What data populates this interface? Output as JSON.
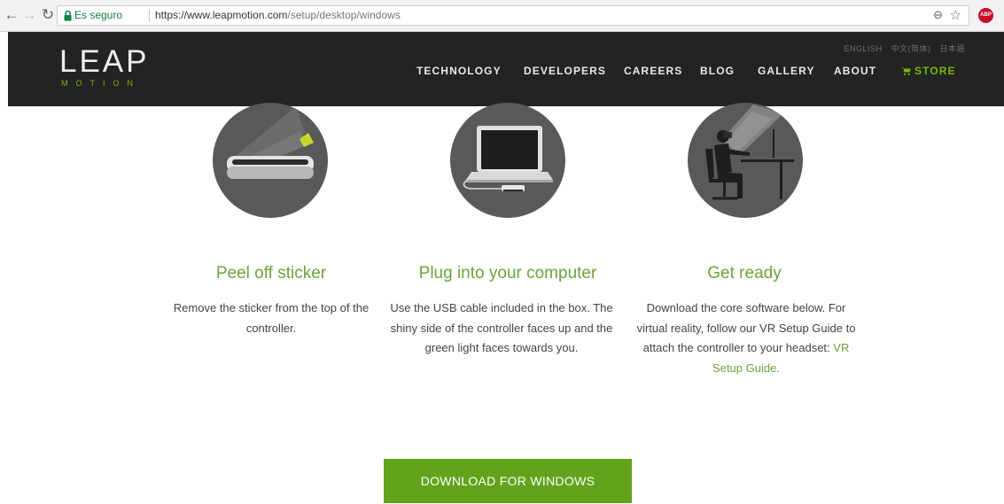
{
  "browser": {
    "secure_label": "Es seguro",
    "url_host": "https://www.leapmotion.com",
    "url_path": "/setup/desktop/windows",
    "extension_badge": "ABP"
  },
  "header": {
    "logo_primary": "LEAP",
    "logo_secondary": "MOTION",
    "languages": [
      "ENGLISH",
      "中文(简体)",
      "日本語"
    ],
    "nav": [
      "TECHNOLOGY",
      "DEVELOPERS",
      "CAREERS",
      "BLOG",
      "GALLERY",
      "ABOUT"
    ],
    "store_label": "STORE",
    "store_color": "#7ab800"
  },
  "steps": [
    {
      "title": "Peel off sticker",
      "text": "Remove the sticker from the top of the controller."
    },
    {
      "title": "Plug into your computer",
      "text": "Use the USB cable included in the box. The shiny side of the controller faces up and the green light faces towards you."
    },
    {
      "title": "Get ready",
      "text": "Download the core software below. For virtual reality, follow our VR Setup Guide to attach the controller to your headset:",
      "link": "VR Setup Guide."
    }
  ],
  "download_label": "DOWNLOAD FOR WINDOWS",
  "colors": {
    "accent": "#6ba43a",
    "button": "#62a31c",
    "header_bg": "#232323",
    "step_circle": "#595959"
  }
}
